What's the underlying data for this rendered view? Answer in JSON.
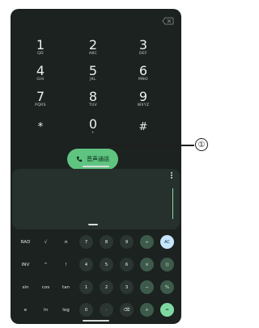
{
  "keypad": {
    "keys": [
      {
        "digit": "1",
        "letters": "QD"
      },
      {
        "digit": "2",
        "letters": "ABC"
      },
      {
        "digit": "3",
        "letters": "DEF"
      },
      {
        "digit": "4",
        "letters": "GHI"
      },
      {
        "digit": "5",
        "letters": "JKL"
      },
      {
        "digit": "6",
        "letters": "MNO"
      },
      {
        "digit": "7",
        "letters": "PQRS"
      },
      {
        "digit": "8",
        "letters": "TUV"
      },
      {
        "digit": "9",
        "letters": "WXYZ"
      },
      {
        "digit": "*",
        "letters": ""
      },
      {
        "digit": "0",
        "letters": "+"
      },
      {
        "digit": "#",
        "letters": ""
      }
    ]
  },
  "call": {
    "label": "音声通話",
    "icon": "phone-icon",
    "color": "#5ec480"
  },
  "calculator": {
    "keys": [
      [
        "RAD",
        "√",
        "π",
        "7",
        "8",
        "9",
        "÷",
        "AC"
      ],
      [
        "INV",
        "^",
        "!",
        "4",
        "5",
        "6",
        "×",
        "()"
      ],
      [
        "sin",
        "cos",
        "tan",
        "1",
        "2",
        "3",
        "−",
        "%"
      ],
      [
        "e",
        "ln",
        "log",
        "0",
        "·",
        "⌫",
        "+",
        "="
      ]
    ]
  },
  "callout": {
    "label": "①"
  },
  "colors": {
    "screen_bg": "#1b2220",
    "accent_green": "#7fd8a2",
    "clear_key": "#c7e5ff"
  }
}
